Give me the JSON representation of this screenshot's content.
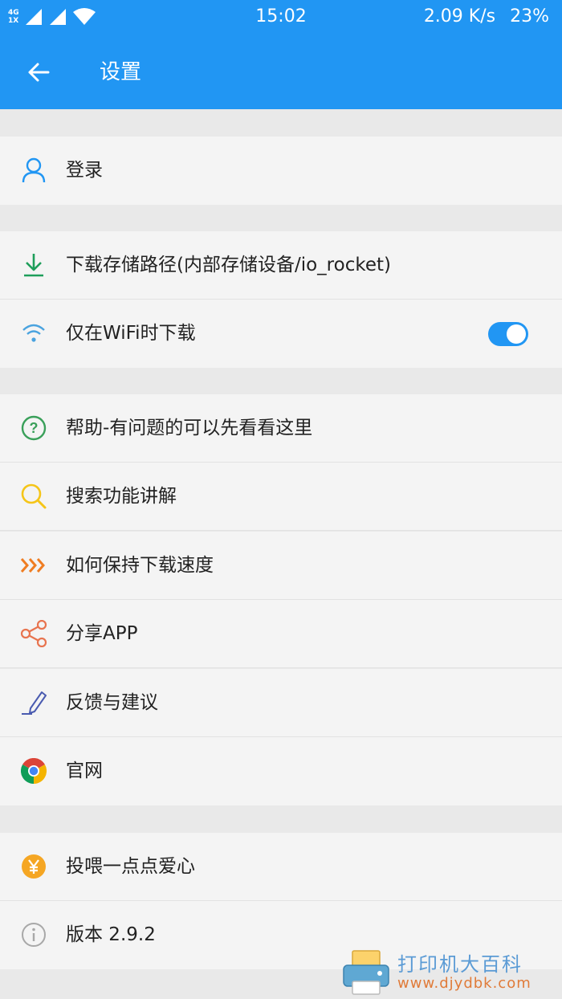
{
  "status_bar": {
    "network_top": "4G",
    "network_bottom": "1X",
    "time": "15:02",
    "speed": "2.09 K/s",
    "battery": "23%"
  },
  "toolbar": {
    "title": "设置",
    "back_icon": "arrow-left-icon"
  },
  "sections": [
    {
      "items": [
        {
          "icon": "user-icon",
          "label": "登录"
        }
      ]
    },
    {
      "items": [
        {
          "icon": "download-icon",
          "label": "下载存储路径(内部存储设备/io_rocket)"
        },
        {
          "icon": "wifi-icon",
          "label": "仅在WiFi时下载",
          "toggle": true
        }
      ]
    },
    {
      "items": [
        {
          "icon": "help-icon",
          "label": "帮助-有问题的可以先看看这里"
        },
        {
          "icon": "search-icon",
          "label": "搜索功能讲解"
        },
        {
          "icon": "chevrons-right-icon",
          "label": "如何保持下载速度"
        },
        {
          "icon": "share-icon",
          "label": "分享APP"
        },
        {
          "icon": "pencil-icon",
          "label": "反馈与建议"
        },
        {
          "icon": "chrome-icon",
          "label": "官网"
        }
      ]
    },
    {
      "items": [
        {
          "icon": "yen-coin-icon",
          "label": "投喂一点点爱心"
        },
        {
          "icon": "info-icon",
          "label": "版本 2.9.2"
        }
      ]
    }
  ],
  "colors": {
    "primary": "#2196f3",
    "row_bg": "#f4f4f4",
    "page_bg": "#e9e9e9"
  },
  "watermark": {
    "line1": "打印机大百科",
    "line2": "www.djydbk.com"
  }
}
